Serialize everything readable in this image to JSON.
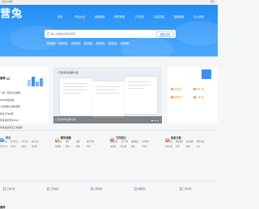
{
  "topbar": {
    "left": "范文大全网！",
    "right": "登录"
  },
  "brand": {
    "logo": "营兔"
  },
  "nav": [
    {
      "label": "首页"
    },
    {
      "label": "作业大全"
    },
    {
      "label": "资源资料"
    },
    {
      "label": "教学资源"
    },
    {
      "label": "工作范文"
    },
    {
      "label": "实用文档"
    },
    {
      "label": "精品教育"
    },
    {
      "label": "办公资料"
    }
  ],
  "search": {
    "placeholder": "输入文章的关键词搜索",
    "button": "搜索文档"
  },
  "hot_tags": [
    "热门标签",
    "热门标签",
    "热门标签",
    "热门标签",
    "热门标签",
    "热门标签",
    "热门标签"
  ],
  "left_section": {
    "title": "推荐",
    "badge": "热",
    "items": [
      "一模一范演示演讲稿",
      "2019年最新版",
      "小学期末演讲稿范例",
      "优秀工作总结",
      "年度总结范文2021",
      "年终总结年度工作报告"
    ]
  },
  "feature": {
    "title": "广西各科年级课件合集",
    "caption": "广西各科年级课件合集"
  },
  "right_section": {
    "perks": [
      "优质文档",
      "免费下载",
      "海量资源",
      "一键下载"
    ]
  },
  "colors": {
    "hero_start": "#1f8df5",
    "hero_end": "#4aa8fd",
    "accent": "#2e7cf6",
    "bar": "#3e8ef7",
    "perk": "#f08a24"
  },
  "categories": [
    {
      "name": "作文",
      "icon": "document-icon",
      "color": "#3e8ef7",
      "subs": [
        "高中作文",
        "初中作文",
        "小学作文",
        "英语作文",
        "作文大全",
        "议论文",
        "记叙文",
        "读后感"
      ]
    },
    {
      "name": "教学资源",
      "icon": "book-icon",
      "color": "#f0a21d",
      "subs": [
        "教案设计",
        "课件",
        "试题",
        "教学反思",
        "说课稿",
        "听课",
        "备课",
        "学案"
      ]
    },
    {
      "name": "工作范文",
      "icon": "briefcase-icon",
      "color": "#f26b5b",
      "subs": [
        "工作总结",
        "工作计划",
        "述职报告",
        "心得体会",
        "演讲稿",
        "发言稿",
        "致辞",
        "申请书"
      ]
    },
    {
      "name": "实用文档",
      "icon": "file-icon",
      "color": "#ff6b45",
      "subs": [
        "合同协议",
        "规章制度",
        "应急预案",
        "策划方案",
        "活动方案",
        "证明",
        "条据",
        "礼仪"
      ]
    }
  ],
  "files": [
    "工作计划",
    "工作总结",
    "心得体会",
    "述职报告",
    "工作计划"
  ],
  "bottom": {
    "title": "推荐"
  }
}
